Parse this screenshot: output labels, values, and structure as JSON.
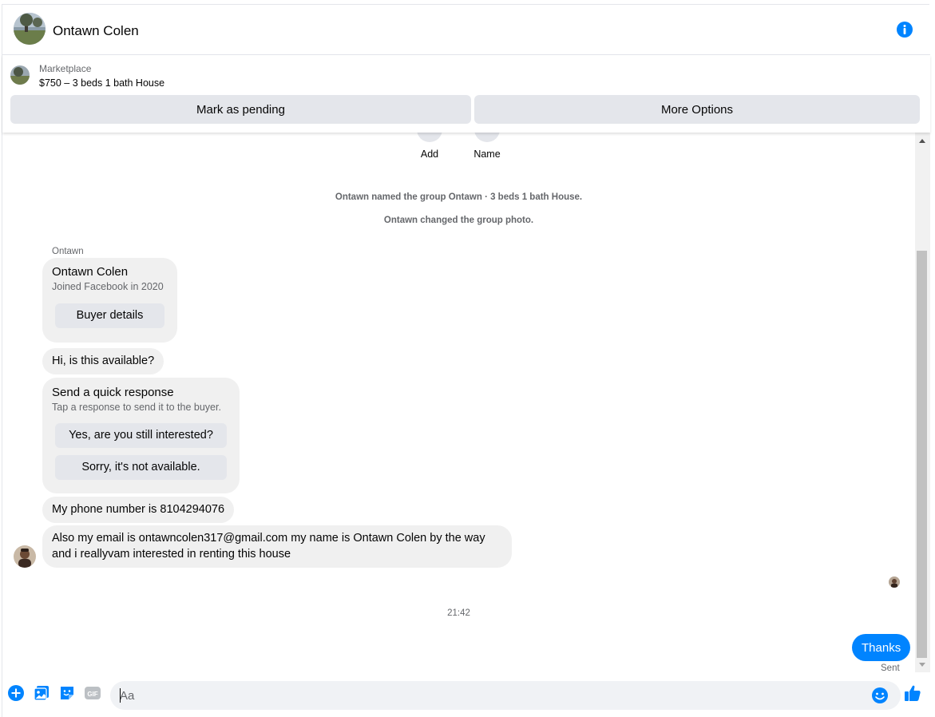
{
  "header": {
    "name": "Ontawn Colen"
  },
  "marketplace": {
    "label": "Marketplace",
    "title": "$750 – 3 beds 1 bath House",
    "pending_button": "Mark as pending",
    "more_button": "More Options"
  },
  "top_actions": {
    "add": "Add",
    "name": "Name"
  },
  "system_messages": [
    "Ontawn named the group Ontawn · 3 beds 1 bath House.",
    "Ontawn changed the group photo."
  ],
  "sender": "Ontawn",
  "profile_card": {
    "name": "Ontawn Colen",
    "joined": "Joined Facebook in 2020",
    "button": "Buyer details"
  },
  "messages": {
    "m1": "Hi, is this available?",
    "m2": "My phone number is 8104294076",
    "m3_line1": "Also my email is ontawncolen317@gmail.com my name is Ontawn Colen by the way",
    "m3_line2": "and i reallyvam interested in renting this house"
  },
  "quick_response": {
    "title": "Send a quick response",
    "subtitle": "Tap a response to send it to the buyer.",
    "option1": "Yes, are you still interested?",
    "option2": "Sorry, it's not available."
  },
  "timestamp": "21:42",
  "outgoing": {
    "text": "Thanks",
    "status": "Sent"
  },
  "composer": {
    "placeholder": "Aa"
  },
  "colors": {
    "accent": "#0084ff",
    "bubble_in": "#f0f0f0",
    "button_bg": "#e4e6eb"
  }
}
